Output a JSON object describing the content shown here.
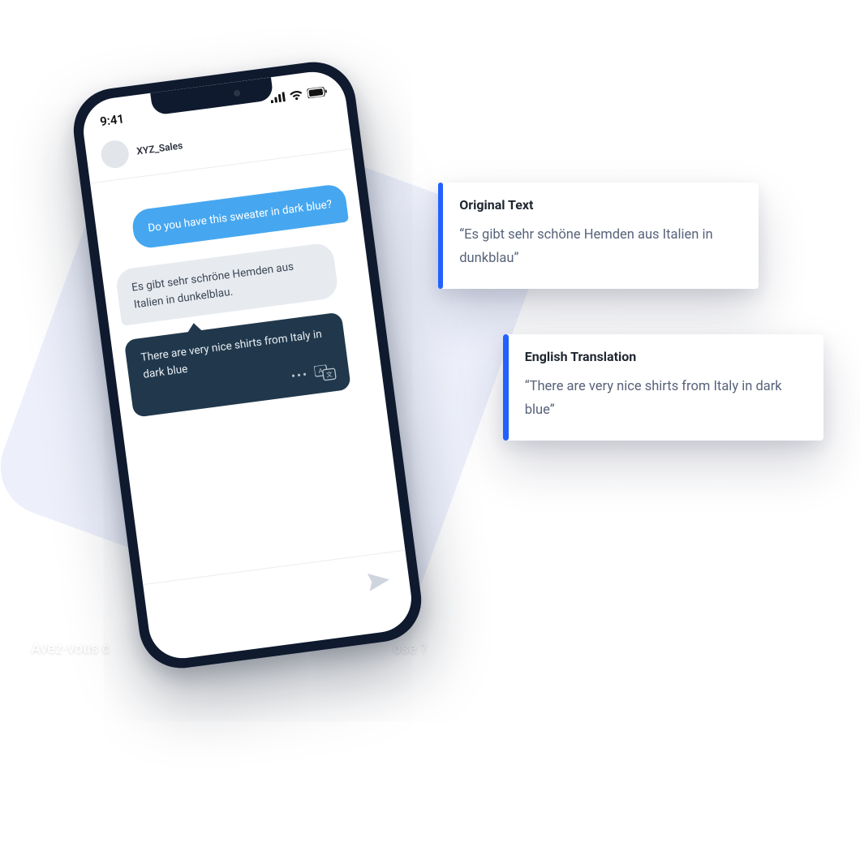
{
  "phone": {
    "time": "9:41",
    "contact": "XYZ_Sales",
    "messages": {
      "sent1": "Do you have this sweater in dark blue?",
      "recv1": "Es gibt sehr schröne Hemden aus Italien in dunkelblau.",
      "translated": "There are very nice shirts from Italy in dark blue"
    }
  },
  "cards": {
    "original": {
      "title": "Original Text",
      "text": "“Es gibt sehr schöne Hemden aus Italien in dunkblau”"
    },
    "translation": {
      "title": "English Translation",
      "text": "“There are very nice shirts from Italy in dark blue”"
    }
  },
  "caption": {
    "left": "Avez-vous c",
    "right": "ose ?"
  }
}
